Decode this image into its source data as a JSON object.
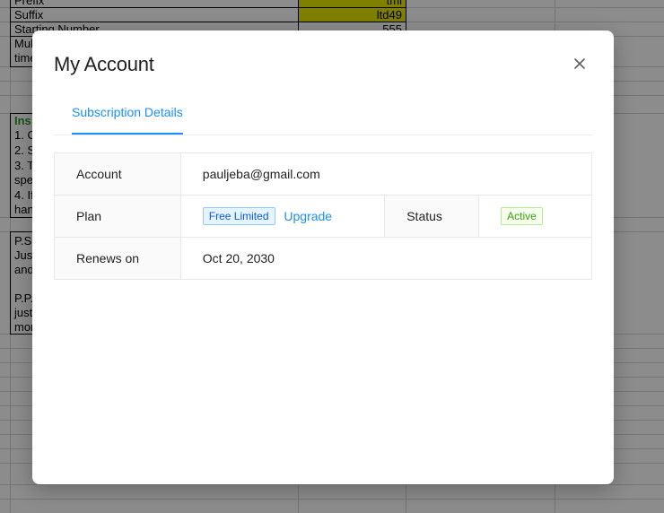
{
  "background_sheet": {
    "rows": [
      {
        "label": "Prefix",
        "value": "tml"
      },
      {
        "label": "Suffix",
        "value": "ltd49"
      },
      {
        "label": "Starting Number",
        "value": "555"
      }
    ],
    "multi_label_a": "Mul",
    "multi_label_b": "time",
    "instructions_header": "Ins",
    "instructions": [
      "1. C",
      "2. S",
      "3. T",
      "spe",
      "4. If",
      "han"
    ],
    "ps_lines": [
      "P.S",
      "Jus",
      "and",
      "",
      "P.P.",
      "just",
      "mor"
    ]
  },
  "modal": {
    "title": "My Account",
    "close_label": "×",
    "tabs": [
      {
        "label": "Subscription Details",
        "active": true
      }
    ],
    "details": {
      "account_label": "Account",
      "account_value": "pauljeba@gmail.com",
      "plan_label": "Plan",
      "plan_tag": "Free Limited",
      "upgrade_link": "Upgrade",
      "status_label": "Status",
      "status_tag": "Active",
      "renews_label": "Renews on",
      "renews_value": "Oct 20, 2030"
    }
  },
  "colors": {
    "accent": "#1890ff",
    "active_green": "#389e0d",
    "overlay": "rgba(0,0,0,0.45)"
  }
}
